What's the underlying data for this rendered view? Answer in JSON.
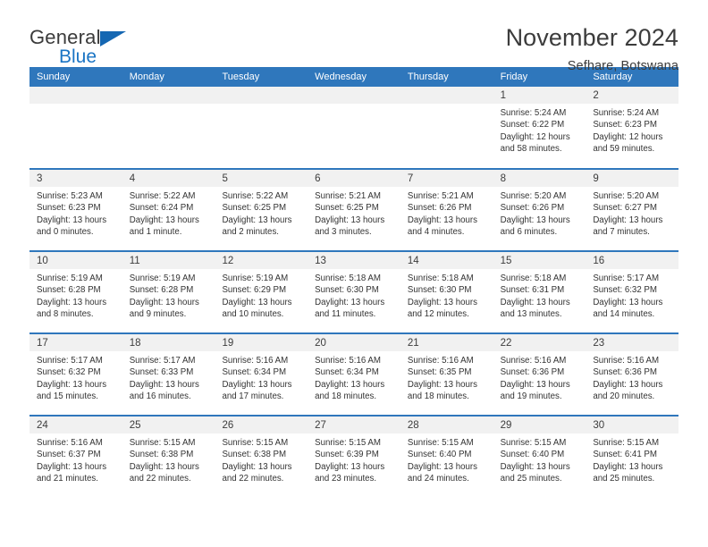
{
  "brand": {
    "name_part1": "General",
    "name_part2": "Blue",
    "triangle_color": "#1567b2",
    "blue_color": "#1a74c4"
  },
  "header": {
    "title": "November 2024",
    "location": "Sefhare, Botswana"
  },
  "theme": {
    "header_blue": "#2f77bc",
    "daynum_band": "#f1f1f1",
    "cell_bg": "#ffffff"
  },
  "weekdays": [
    "Sunday",
    "Monday",
    "Tuesday",
    "Wednesday",
    "Thursday",
    "Friday",
    "Saturday"
  ],
  "weeks": [
    [
      {
        "day": "",
        "empty": true,
        "lines": []
      },
      {
        "day": "",
        "empty": true,
        "lines": []
      },
      {
        "day": "",
        "empty": true,
        "lines": []
      },
      {
        "day": "",
        "empty": true,
        "lines": []
      },
      {
        "day": "",
        "empty": true,
        "lines": []
      },
      {
        "day": "1",
        "empty": false,
        "lines": [
          "Sunrise: 5:24 AM",
          "Sunset: 6:22 PM",
          "Daylight: 12 hours",
          "and 58 minutes."
        ]
      },
      {
        "day": "2",
        "empty": false,
        "lines": [
          "Sunrise: 5:24 AM",
          "Sunset: 6:23 PM",
          "Daylight: 12 hours",
          "and 59 minutes."
        ]
      }
    ],
    [
      {
        "day": "3",
        "empty": false,
        "lines": [
          "Sunrise: 5:23 AM",
          "Sunset: 6:23 PM",
          "Daylight: 13 hours",
          "and 0 minutes."
        ]
      },
      {
        "day": "4",
        "empty": false,
        "lines": [
          "Sunrise: 5:22 AM",
          "Sunset: 6:24 PM",
          "Daylight: 13 hours",
          "and 1 minute."
        ]
      },
      {
        "day": "5",
        "empty": false,
        "lines": [
          "Sunrise: 5:22 AM",
          "Sunset: 6:25 PM",
          "Daylight: 13 hours",
          "and 2 minutes."
        ]
      },
      {
        "day": "6",
        "empty": false,
        "lines": [
          "Sunrise: 5:21 AM",
          "Sunset: 6:25 PM",
          "Daylight: 13 hours",
          "and 3 minutes."
        ]
      },
      {
        "day": "7",
        "empty": false,
        "lines": [
          "Sunrise: 5:21 AM",
          "Sunset: 6:26 PM",
          "Daylight: 13 hours",
          "and 4 minutes."
        ]
      },
      {
        "day": "8",
        "empty": false,
        "lines": [
          "Sunrise: 5:20 AM",
          "Sunset: 6:26 PM",
          "Daylight: 13 hours",
          "and 6 minutes."
        ]
      },
      {
        "day": "9",
        "empty": false,
        "lines": [
          "Sunrise: 5:20 AM",
          "Sunset: 6:27 PM",
          "Daylight: 13 hours",
          "and 7 minutes."
        ]
      }
    ],
    [
      {
        "day": "10",
        "empty": false,
        "lines": [
          "Sunrise: 5:19 AM",
          "Sunset: 6:28 PM",
          "Daylight: 13 hours",
          "and 8 minutes."
        ]
      },
      {
        "day": "11",
        "empty": false,
        "lines": [
          "Sunrise: 5:19 AM",
          "Sunset: 6:28 PM",
          "Daylight: 13 hours",
          "and 9 minutes."
        ]
      },
      {
        "day": "12",
        "empty": false,
        "lines": [
          "Sunrise: 5:19 AM",
          "Sunset: 6:29 PM",
          "Daylight: 13 hours",
          "and 10 minutes."
        ]
      },
      {
        "day": "13",
        "empty": false,
        "lines": [
          "Sunrise: 5:18 AM",
          "Sunset: 6:30 PM",
          "Daylight: 13 hours",
          "and 11 minutes."
        ]
      },
      {
        "day": "14",
        "empty": false,
        "lines": [
          "Sunrise: 5:18 AM",
          "Sunset: 6:30 PM",
          "Daylight: 13 hours",
          "and 12 minutes."
        ]
      },
      {
        "day": "15",
        "empty": false,
        "lines": [
          "Sunrise: 5:18 AM",
          "Sunset: 6:31 PM",
          "Daylight: 13 hours",
          "and 13 minutes."
        ]
      },
      {
        "day": "16",
        "empty": false,
        "lines": [
          "Sunrise: 5:17 AM",
          "Sunset: 6:32 PM",
          "Daylight: 13 hours",
          "and 14 minutes."
        ]
      }
    ],
    [
      {
        "day": "17",
        "empty": false,
        "lines": [
          "Sunrise: 5:17 AM",
          "Sunset: 6:32 PM",
          "Daylight: 13 hours",
          "and 15 minutes."
        ]
      },
      {
        "day": "18",
        "empty": false,
        "lines": [
          "Sunrise: 5:17 AM",
          "Sunset: 6:33 PM",
          "Daylight: 13 hours",
          "and 16 minutes."
        ]
      },
      {
        "day": "19",
        "empty": false,
        "lines": [
          "Sunrise: 5:16 AM",
          "Sunset: 6:34 PM",
          "Daylight: 13 hours",
          "and 17 minutes."
        ]
      },
      {
        "day": "20",
        "empty": false,
        "lines": [
          "Sunrise: 5:16 AM",
          "Sunset: 6:34 PM",
          "Daylight: 13 hours",
          "and 18 minutes."
        ]
      },
      {
        "day": "21",
        "empty": false,
        "lines": [
          "Sunrise: 5:16 AM",
          "Sunset: 6:35 PM",
          "Daylight: 13 hours",
          "and 18 minutes."
        ]
      },
      {
        "day": "22",
        "empty": false,
        "lines": [
          "Sunrise: 5:16 AM",
          "Sunset: 6:36 PM",
          "Daylight: 13 hours",
          "and 19 minutes."
        ]
      },
      {
        "day": "23",
        "empty": false,
        "lines": [
          "Sunrise: 5:16 AM",
          "Sunset: 6:36 PM",
          "Daylight: 13 hours",
          "and 20 minutes."
        ]
      }
    ],
    [
      {
        "day": "24",
        "empty": false,
        "lines": [
          "Sunrise: 5:16 AM",
          "Sunset: 6:37 PM",
          "Daylight: 13 hours",
          "and 21 minutes."
        ]
      },
      {
        "day": "25",
        "empty": false,
        "lines": [
          "Sunrise: 5:15 AM",
          "Sunset: 6:38 PM",
          "Daylight: 13 hours",
          "and 22 minutes."
        ]
      },
      {
        "day": "26",
        "empty": false,
        "lines": [
          "Sunrise: 5:15 AM",
          "Sunset: 6:38 PM",
          "Daylight: 13 hours",
          "and 22 minutes."
        ]
      },
      {
        "day": "27",
        "empty": false,
        "lines": [
          "Sunrise: 5:15 AM",
          "Sunset: 6:39 PM",
          "Daylight: 13 hours",
          "and 23 minutes."
        ]
      },
      {
        "day": "28",
        "empty": false,
        "lines": [
          "Sunrise: 5:15 AM",
          "Sunset: 6:40 PM",
          "Daylight: 13 hours",
          "and 24 minutes."
        ]
      },
      {
        "day": "29",
        "empty": false,
        "lines": [
          "Sunrise: 5:15 AM",
          "Sunset: 6:40 PM",
          "Daylight: 13 hours",
          "and 25 minutes."
        ]
      },
      {
        "day": "30",
        "empty": false,
        "lines": [
          "Sunrise: 5:15 AM",
          "Sunset: 6:41 PM",
          "Daylight: 13 hours",
          "and 25 minutes."
        ]
      }
    ]
  ]
}
